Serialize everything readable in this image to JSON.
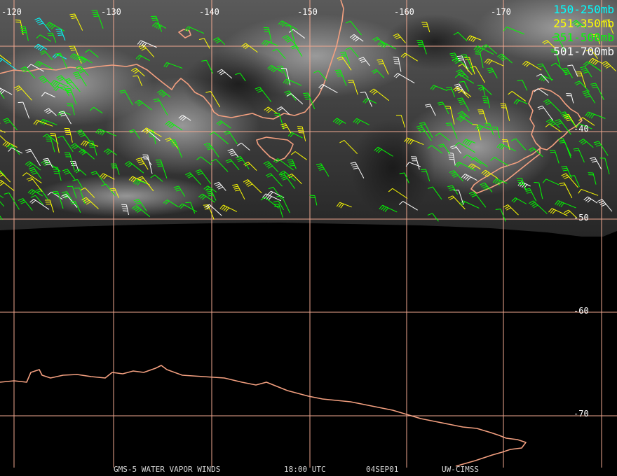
{
  "map": {
    "longitude_labels": [
      "-120",
      "-130",
      "-140",
      "-150",
      "-160",
      "-170"
    ],
    "latitude_labels": [
      "-40",
      "-50",
      "-60",
      "-70"
    ],
    "legend": [
      {
        "label": "150-250mb",
        "color": "#00ffff"
      },
      {
        "label": "251-350mb",
        "color": "#ffff00"
      },
      {
        "label": "351-500mb",
        "color": "#00ff00"
      },
      {
        "label": "501-700mb",
        "color": "#ffffff"
      }
    ],
    "footer": {
      "product": "GMS-5 WATER VAPOR WINDS",
      "time": "18:00 UTC",
      "date": "04SEP01",
      "source": "UW-CIMSS"
    },
    "colors": {
      "grid": "#f0a890",
      "coastline": "#f4a080",
      "background": "#000000"
    }
  }
}
